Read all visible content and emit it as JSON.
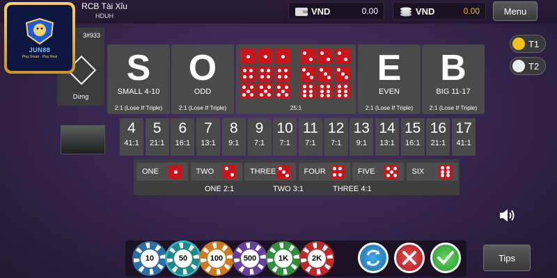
{
  "header": {
    "room_name": "RCB Tài Xỉu",
    "room_code": "HDUH",
    "wallet_1": {
      "currency": "VND",
      "amount": "0.00"
    },
    "wallet_2": {
      "currency": "VND",
      "amount": "0.00"
    },
    "menu_label": "Menu"
  },
  "logo": {
    "brand": "JUN88",
    "tagline": "Play Smart · Play Real"
  },
  "status": {
    "round": "3#933",
    "state": "Dừng"
  },
  "bets": {
    "small": {
      "letter": "S",
      "label": "SMALL 4-10",
      "payout": "2:1  (Lose If Triple)"
    },
    "odd": {
      "letter": "O",
      "label": "ODD",
      "payout": "2:1  (Lose If Triple)"
    },
    "triple": {
      "payout": "25:1"
    },
    "even": {
      "letter": "E",
      "label": "EVEN",
      "payout": "2:1  (Lose If Triple)"
    },
    "big": {
      "letter": "B",
      "label": "BIG 11-17",
      "payout": "2:1  (Lose If Triple)"
    }
  },
  "totals": [
    {
      "n": "4",
      "odds": "41:1"
    },
    {
      "n": "5",
      "odds": "21:1"
    },
    {
      "n": "6",
      "odds": "16:1"
    },
    {
      "n": "7",
      "odds": "13:1"
    },
    {
      "n": "8",
      "odds": "9:1"
    },
    {
      "n": "9",
      "odds": "7:1"
    },
    {
      "n": "10",
      "odds": "7:1"
    },
    {
      "n": "11",
      "odds": "7:1"
    },
    {
      "n": "12",
      "odds": "7:1"
    },
    {
      "n": "13",
      "odds": "9:1"
    },
    {
      "n": "14",
      "odds": "13:1"
    },
    {
      "n": "15",
      "odds": "16:1"
    },
    {
      "n": "16",
      "odds": "21:1"
    },
    {
      "n": "17",
      "odds": "41:1"
    }
  ],
  "singles": [
    {
      "label": "ONE",
      "face": 1
    },
    {
      "label": "TWO",
      "face": 2
    },
    {
      "label": "THREE",
      "face": 3
    },
    {
      "label": "FOUR",
      "face": 4
    },
    {
      "label": "FIVE",
      "face": 5
    },
    {
      "label": "SIX",
      "face": 6
    }
  ],
  "multipliers": {
    "one": "ONE  2:1",
    "two": "TWO  3:1",
    "three": "THREE  4:1"
  },
  "toggles": {
    "t1": "T1",
    "t2": "T2"
  },
  "chips": [
    {
      "label": "10",
      "color": "#2a6fa8"
    },
    {
      "label": "50",
      "color": "#1d8a8a",
      "selected": true
    },
    {
      "label": "100",
      "color": "#d07a1c"
    },
    {
      "label": "500",
      "color": "#6a3fa0"
    },
    {
      "label": "1K",
      "color": "#2f8f3a"
    },
    {
      "label": "2K",
      "color": "#c0282d"
    }
  ],
  "actions": {
    "rebet_icon": "repeat-icon",
    "cancel_icon": "cancel-icon",
    "confirm_icon": "check-icon"
  },
  "tips_label": "Tips",
  "colors": {
    "die_red": "#c8141b",
    "tile_gray": "#4a4a4a",
    "t1_yellow": "#f2c21a",
    "accent_teal": "#2fb6c8"
  }
}
